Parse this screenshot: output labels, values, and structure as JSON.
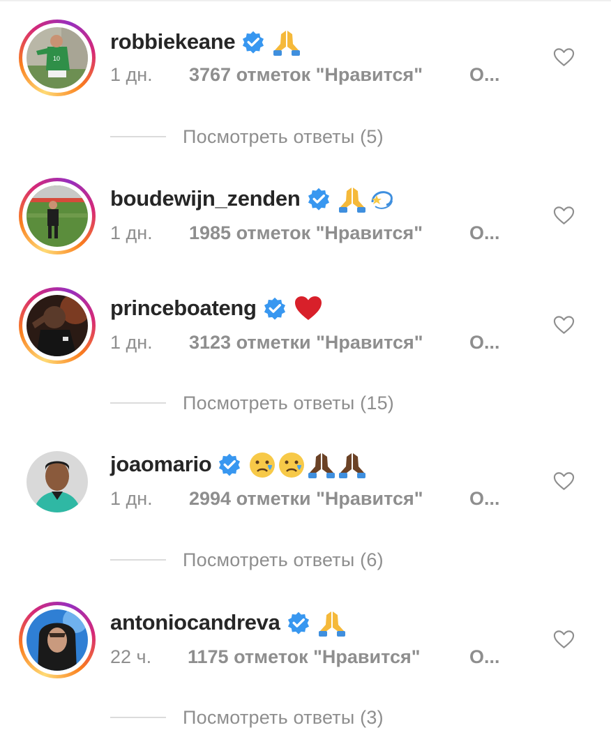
{
  "comments": [
    {
      "username": "robbiekeane",
      "emoji": "🙏",
      "time": "1 дн.",
      "likes": "3767 отметок \"Нравится\"",
      "reply": "О...",
      "view_replies": "Посмотреть ответы (5)",
      "has_story_ring": true
    },
    {
      "username": "boudewijn_zenden",
      "emoji": "🙏💫",
      "time": "1 дн.",
      "likes": "1985 отметок \"Нравится\"",
      "reply": "О...",
      "view_replies": "",
      "has_story_ring": true
    },
    {
      "username": "princeboateng",
      "emoji": "❤️",
      "time": "1 дн.",
      "likes": "3123 отметки \"Нравится\"",
      "reply": "О...",
      "view_replies": "Посмотреть ответы (15)",
      "has_story_ring": true
    },
    {
      "username": "joaomario",
      "emoji": "😢😢🙏🏿🙏🏿",
      "time": "1 дн.",
      "likes": "2994 отметки \"Нравится\"",
      "reply": "О...",
      "view_replies": "Посмотреть ответы (6)",
      "has_story_ring": false
    },
    {
      "username": "antoniocandreva",
      "emoji": "🙏",
      "time": "22 ч.",
      "likes": "1175 отметок \"Нравится\"",
      "reply": "О...",
      "view_replies": "Посмотреть ответы (3)",
      "has_story_ring": true
    }
  ],
  "icons": {
    "verified": "verified-badge-icon",
    "like": "heart-outline-icon"
  },
  "colors": {
    "text_primary": "#262626",
    "text_secondary": "#8e8e8e",
    "verified_blue": "#3897f0",
    "divider": "#dbdbdb"
  }
}
